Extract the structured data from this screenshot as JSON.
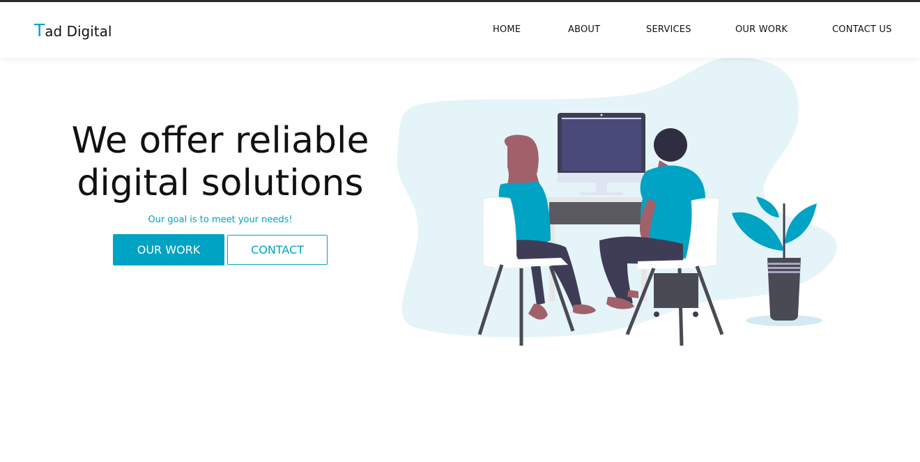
{
  "brand": {
    "first_letter": "T",
    "rest": "ad Digital"
  },
  "nav": {
    "items": [
      {
        "label": "HOME"
      },
      {
        "label": "ABOUT"
      },
      {
        "label": "SERVICES"
      },
      {
        "label": "OUR WORK"
      },
      {
        "label": "CONTACT US"
      }
    ]
  },
  "hero": {
    "title_line1": "We offer reliable",
    "title_line2": "digital solutions",
    "tagline": "Our goal is to meet your needs!",
    "primary_button": "OUR WORK",
    "secondary_button": "CONTACT"
  },
  "colors": {
    "accent": "#00a3c4",
    "text": "#111111",
    "blob": "#e5f4f8",
    "shirt": "#00a3c4",
    "pants": "#3f3d56",
    "hair_woman": "#a0616a",
    "hair_man": "#2f2e41",
    "monitor": "#4a4a7a"
  },
  "illustration": {
    "name": "two-people-at-computer-illustration"
  }
}
